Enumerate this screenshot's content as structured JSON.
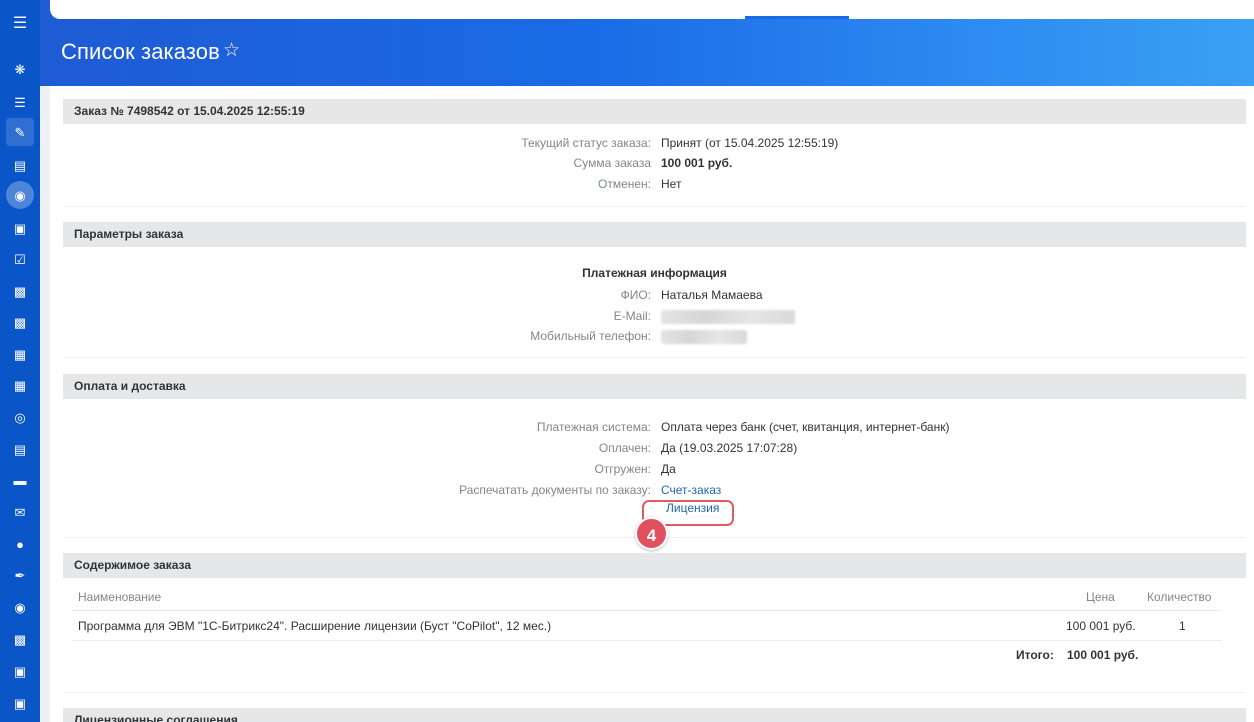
{
  "page": {
    "title": "Список заказов"
  },
  "rail": {
    "icons": [
      "menu-icon",
      "bitrix-icon",
      "filter-icon",
      "edit-icon",
      "contact-card-icon",
      "active-module-icon",
      "window-icon",
      "checkbox-icon",
      "chat-icon",
      "robot-icon",
      "calendar-icon",
      "calendar-tasks-icon",
      "target-icon",
      "document-icon",
      "storage-icon",
      "mail-icon",
      "users-icon",
      "sign-icon",
      "circle-icon",
      "presentation-icon",
      "bank-icon",
      "cart-icon"
    ]
  },
  "order": {
    "header": "Заказ № 7498542 от 15.04.2025 12:55:19",
    "status_label": "Текущий статус заказа:",
    "status_value": "Принят (от 15.04.2025 12:55:19)",
    "sum_label": "Сумма заказа",
    "sum_value": "100 001 руб.",
    "cancel_label": "Отменен:",
    "cancel_value": "Нет"
  },
  "params": {
    "header": "Параметры заказа",
    "payment_info_title": "Платежная информация",
    "fio_label": "ФИО:",
    "fio_value": "Наталья Мамаева",
    "email_label": "E-Mail:",
    "phone_label": "Мобильный телефон:"
  },
  "payment": {
    "header": "Оплата и доставка",
    "system_label": "Платежная система:",
    "system_value": "Оплата через банк (счет, квитанция, интернет-банк)",
    "paid_label": "Оплачен:",
    "paid_value": "Да (19.03.2025 17:07:28)",
    "shipped_label": "Отгружен:",
    "shipped_value": "Да",
    "print_label": "Распечатать документы по заказу:",
    "doc_invoice": "Счет-заказ",
    "doc_license": "Лицензия",
    "step_number": "4"
  },
  "contents": {
    "header": "Содержимое заказа",
    "col_name": "Наименование",
    "col_price": "Цена",
    "col_qty": "Количество",
    "rows": [
      {
        "name": "Программа для ЭВМ \"1С-Битрикс24\". Расширение лицензии (Буст \"CoPilot\", 12 мес.)",
        "price": "100 001 руб.",
        "qty": "1"
      }
    ],
    "total_label": "Итого:",
    "total_value": "100 001 руб."
  },
  "next_section": {
    "header": "Лицензионные соглашения"
  },
  "colors": {
    "accent": "#1a6be6",
    "rail": "#0a56c9",
    "highlight": "#e05a66",
    "link": "#2067b0"
  }
}
